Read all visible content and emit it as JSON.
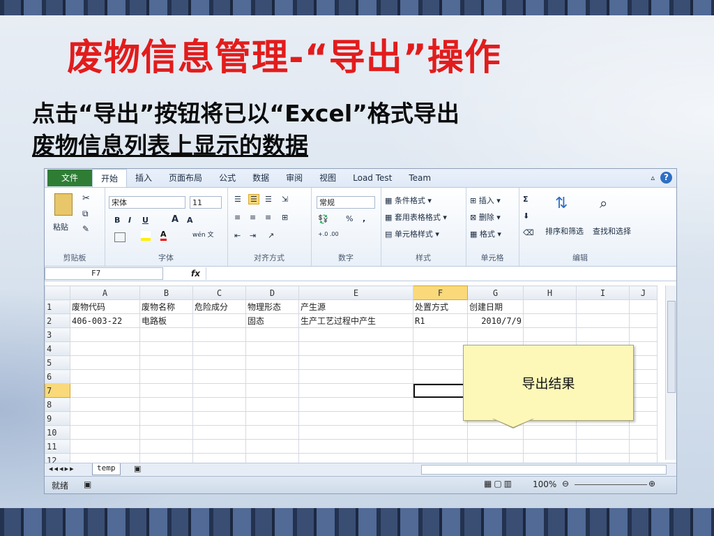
{
  "slide": {
    "title": "废物信息管理-“导出”操作",
    "subtitle_line1": "点击“导出”按钮将已以“Excel”格式导出",
    "subtitle_line2": "废物信息列表上显示的数据"
  },
  "excel": {
    "tabs": [
      "文件",
      "开始",
      "插入",
      "页面布局",
      "公式",
      "数据",
      "审阅",
      "视图",
      "Load Test",
      "Team"
    ],
    "active_tab": "开始",
    "ribbon": {
      "clipboard": {
        "label": "剪贴板",
        "paste": "粘贴"
      },
      "font": {
        "label": "字体",
        "family": "宋体",
        "size": "11",
        "bold": "B",
        "italic": "I",
        "underline": "U",
        "grow": "A",
        "shrink": "A",
        "color_a": "A",
        "wen": "wén 文"
      },
      "alignment": {
        "label": "对齐方式"
      },
      "number": {
        "label": "数字",
        "format": "常规",
        "percent": "%",
        "comma": ",",
        "inc": "+.0 .00",
        "dec": ".00 +.0"
      },
      "styles": {
        "label": "样式",
        "cond": "条件格式",
        "table": "套用表格格式",
        "cell": "单元格样式"
      },
      "cells": {
        "label": "单元格",
        "insert": "插入",
        "delete": "删除",
        "format": "格式"
      },
      "editing": {
        "label": "编辑",
        "sigma": "Σ",
        "sort": "排序和筛选",
        "find": "查找和选择"
      }
    },
    "namebox": "F7",
    "fx": "fx",
    "columns": [
      "A",
      "B",
      "C",
      "D",
      "E",
      "F",
      "G",
      "H",
      "I",
      "J"
    ],
    "rows": [
      [
        "1",
        "废物代码",
        "废物名称",
        "危险成分",
        "物理形态",
        "产生源",
        "处置方式",
        "创建日期",
        "",
        ""
      ],
      [
        "2",
        "406-003-22",
        "电路板",
        "",
        "固态",
        "生产工艺过程中产生",
        "R1",
        "2010/7/9",
        "",
        ""
      ],
      [
        "3",
        "",
        "",
        "",
        "",
        "",
        "",
        "",
        "",
        ""
      ],
      [
        "4",
        "",
        "",
        "",
        "",
        "",
        "",
        "",
        "",
        ""
      ],
      [
        "5",
        "",
        "",
        "",
        "",
        "",
        "",
        "",
        "",
        ""
      ],
      [
        "6",
        "",
        "",
        "",
        "",
        "",
        "",
        "",
        "",
        ""
      ],
      [
        "7",
        "",
        "",
        "",
        "",
        "",
        "",
        "",
        "",
        ""
      ],
      [
        "8",
        "",
        "",
        "",
        "",
        "",
        "",
        "",
        "",
        ""
      ],
      [
        "9",
        "",
        "",
        "",
        "",
        "",
        "",
        "",
        "",
        ""
      ],
      [
        "10",
        "",
        "",
        "",
        "",
        "",
        "",
        "",
        "",
        ""
      ],
      [
        "11",
        "",
        "",
        "",
        "",
        "",
        "",
        "",
        "",
        ""
      ],
      [
        "12",
        "",
        "",
        "",
        "",
        "",
        "",
        "",
        "",
        ""
      ]
    ],
    "sheet_tab": "temp",
    "status_ready": "就绪",
    "zoom": "100%"
  },
  "callout": "导出结果",
  "colors": {
    "title": "#e21c1c",
    "file_tab": "#2f7d35",
    "selection": "#f9d97a"
  }
}
